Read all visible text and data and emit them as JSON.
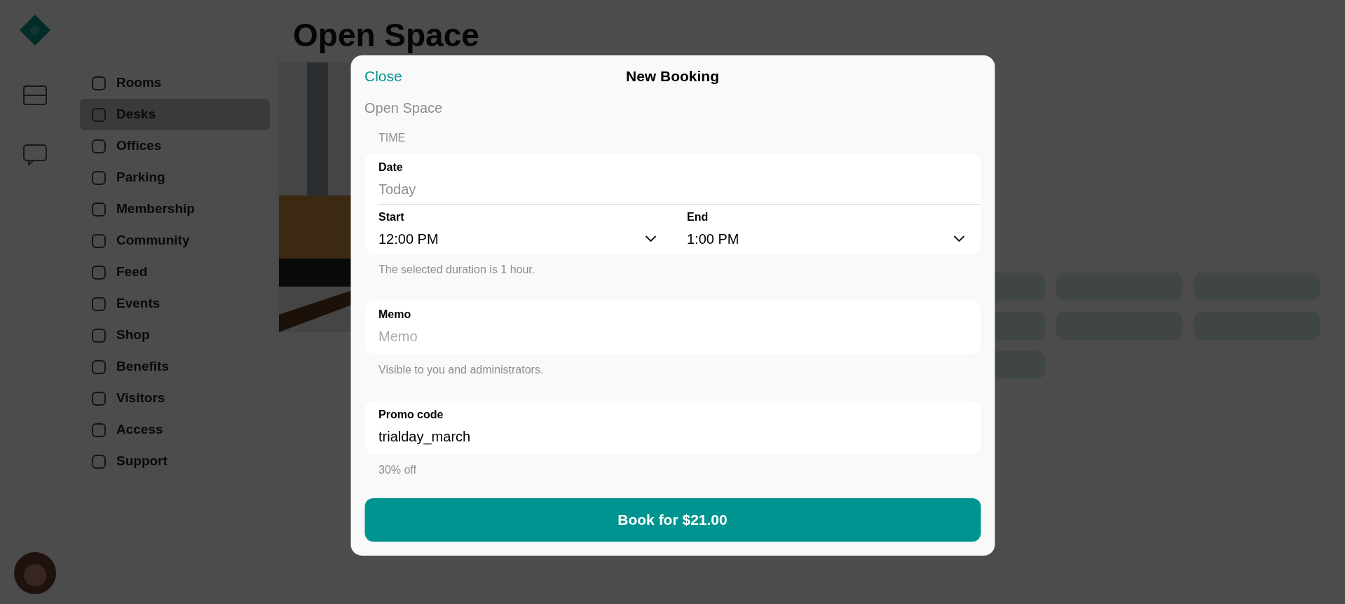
{
  "background": {
    "page_title": "Open Space",
    "nav": [
      {
        "label": "Rooms",
        "selected": false
      },
      {
        "label": "Desks",
        "selected": true
      },
      {
        "label": "Offices",
        "selected": false
      },
      {
        "label": "Parking",
        "selected": false
      },
      {
        "label": "Membership",
        "selected": false
      },
      {
        "label": "Community",
        "selected": false
      },
      {
        "label": "Feed",
        "selected": false
      },
      {
        "label": "Events",
        "selected": false
      },
      {
        "label": "Shop",
        "selected": false
      },
      {
        "label": "Benefits",
        "selected": false
      },
      {
        "label": "Visitors",
        "selected": false
      },
      {
        "label": "Access",
        "selected": false
      },
      {
        "label": "Support",
        "selected": false
      }
    ]
  },
  "modal": {
    "close": "Close",
    "title": "New Booking",
    "subtitle": "Open Space",
    "section": "TIME",
    "date": {
      "label": "Date",
      "value": "Today"
    },
    "start": {
      "label": "Start",
      "value": "12:00 PM"
    },
    "end": {
      "label": "End",
      "value": "1:00 PM"
    },
    "duration_note": "The selected duration is 1 hour.",
    "memo": {
      "label": "Memo",
      "placeholder": "Memo",
      "note": "Visible to you and administrators."
    },
    "promo": {
      "label": "Promo code",
      "value": "trialday_march",
      "note": "30% off"
    },
    "submit": "Book for $21.00"
  }
}
